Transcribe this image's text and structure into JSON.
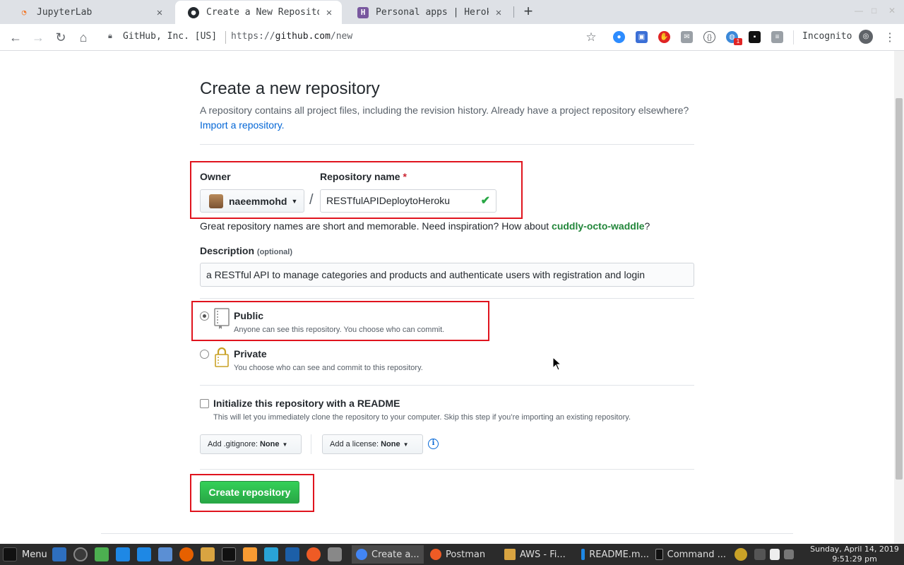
{
  "browser": {
    "tabs": [
      {
        "title": "JupyterLab",
        "close": "✕"
      },
      {
        "title": "Create a New Repository",
        "close": "✕"
      },
      {
        "title": "Personal apps | Heroku",
        "close": "✕"
      }
    ],
    "new_tab": "+",
    "site_identity": "GitHub, Inc. [US]",
    "url_scheme": "https://",
    "url_host": "github.com",
    "url_path": "/new",
    "incognito_label": "Incognito",
    "extension_badge": "1"
  },
  "page": {
    "title": "Create a new repository",
    "lead_text": "A repository contains all project files, including the revision history. Already have a project repository elsewhere?",
    "import_link": "Import a repository.",
    "owner_label": "Owner",
    "owner_value": "naeemmohd",
    "slash": "/",
    "repo_name_label": "Repository name",
    "required_mark": "*",
    "repo_name_value": "RESTfulAPIDeploytoHeroku",
    "hint_text": "Great repository names are short and memorable. Need inspiration? How about",
    "hint_suggestion": "cuddly-octo-waddle",
    "hint_end": "?",
    "description_label": "Description",
    "description_optional": "(optional)",
    "description_value": "a RESTful API to manage categories and products and authenticate users with registration and login",
    "visibility": {
      "selected": "Public",
      "public_title": "Public",
      "public_note": "Anyone can see this repository. You choose who can commit.",
      "private_title": "Private",
      "private_note": "You choose who can see and commit to this repository."
    },
    "readme_title": "Initialize this repository with a README",
    "readme_note": "This will let you immediately clone the repository to your computer. Skip this step if you’re importing an existing repository.",
    "gitignore_label": "Add .gitignore:",
    "gitignore_value": "None",
    "license_label": "Add a license:",
    "license_value": "None",
    "create_button": "Create repository"
  },
  "taskbar": {
    "menu_label": "Menu",
    "windows": [
      {
        "label": "Create a..."
      },
      {
        "label": "Postman"
      },
      {
        "label": "AWS - Fi..."
      },
      {
        "label": "README.m..."
      },
      {
        "label": "Command ..."
      }
    ],
    "clock_date": "Sunday, April 14, 2019",
    "clock_time": "9:51:29 pm"
  },
  "colors": {
    "accent_green": "#28a745",
    "link_blue": "#0366d6",
    "highlight_red": "#e0141e"
  }
}
